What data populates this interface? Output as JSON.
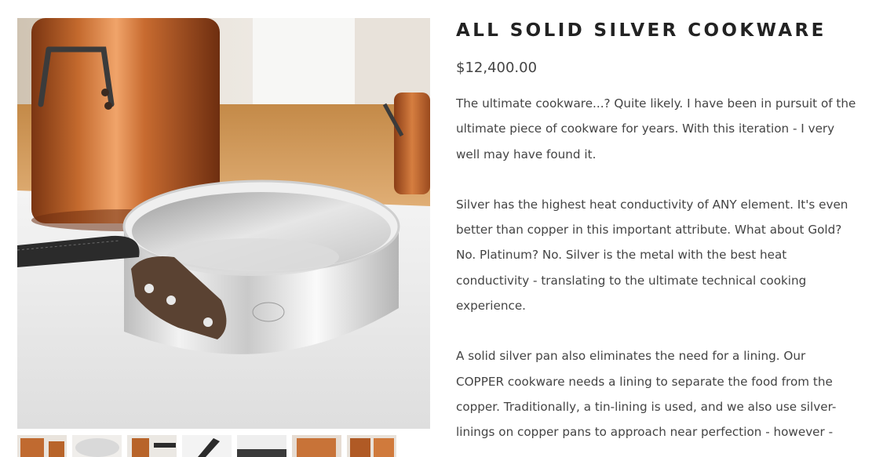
{
  "product": {
    "title": "ALL SOLID SILVER COOKWARE",
    "price": "$12,400.00",
    "main_image": "silver-saute-pan-photo",
    "thumbnails": [
      {
        "icon": "copper-pot-thumbnail"
      },
      {
        "icon": "silver-pan-thumbnail"
      },
      {
        "icon": "handle-closeup-thumbnail"
      },
      {
        "icon": "pan-handle-thumbnail"
      },
      {
        "icon": "silver-pan-side-thumbnail"
      },
      {
        "icon": "copper-pan-thumbnail"
      },
      {
        "icon": "copper-pot-thumbnail-2"
      }
    ]
  },
  "description": {
    "paragraphs": [
      {
        "lines": [
          "The ultimate cookware...?  Quite likely.  I have been in pursuit of the",
          "ultimate piece of cookware for years.  With this iteration - I very",
          "well may have found it."
        ]
      },
      {
        "lines": [
          "Silver has the highest heat conductivity of ANY element.  It's even",
          "better than copper in this important attribute.  What about Gold?",
          "No.  Platinum? No.  Silver is the metal with the best heat",
          "conductivity - translating to the ultimate technical cooking",
          "experience."
        ]
      },
      {
        "lines": [
          "A solid silver pan also eliminates the need for a lining.  Our",
          "COPPER cookware needs a lining to separate the food from the",
          "copper.  Traditionally, a tin-lining is used, and we also use silver-",
          "linings on copper pans to approach near perfection - however -"
        ]
      }
    ]
  },
  "colors": {
    "copper": "#b8642a",
    "silver": "#d9d9d9",
    "handle": "#2b2b2b",
    "text": "#444444"
  }
}
